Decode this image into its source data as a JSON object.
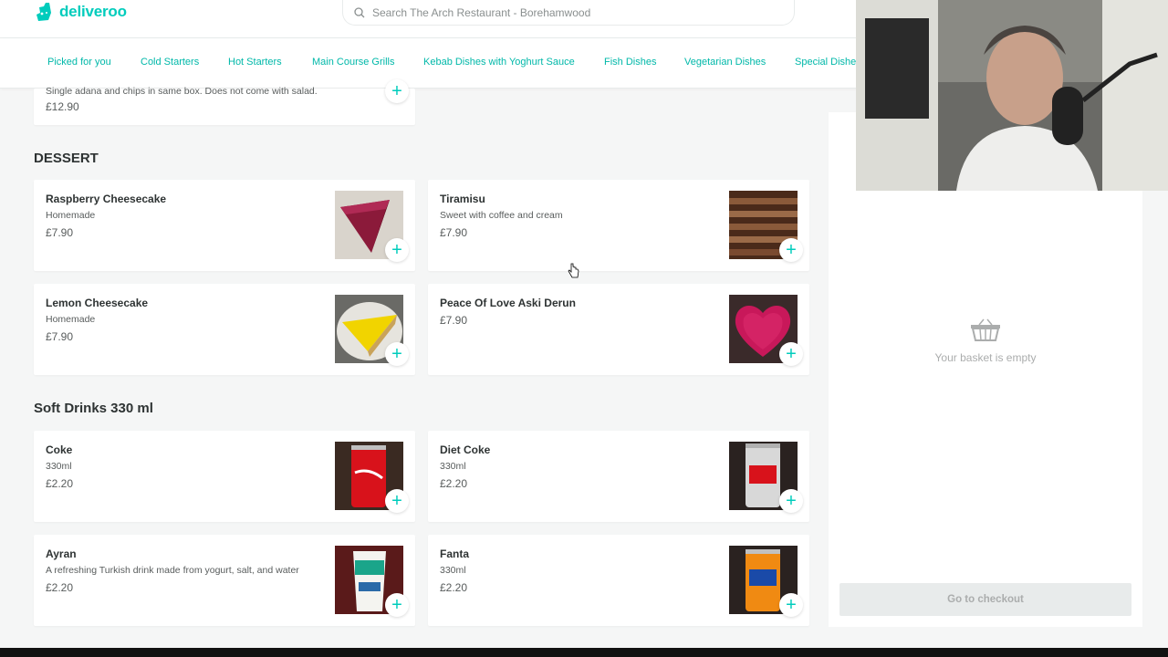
{
  "brand": {
    "name": "deliveroo",
    "color": "#00ccbc"
  },
  "search": {
    "placeholder": "Search The Arch Restaurant - Borehamwood"
  },
  "categories": [
    "Picked for you",
    "Cold Starters",
    "Hot Starters",
    "Main Course Grills",
    "Kebab Dishes with Yoghurt Sauce",
    "Fish Dishes",
    "Vegetarian Dishes",
    "Special Dishes"
  ],
  "previous_item": {
    "desc": "Single adana and chips in same box. Does not come with salad.",
    "price": "£12.90"
  },
  "sections": [
    {
      "title": "DESSERT",
      "items": [
        {
          "name": "Raspberry Cheesecake",
          "desc": "Homemade",
          "price": "£7.90",
          "image": "raspberry-cheesecake"
        },
        {
          "name": "Tiramisu",
          "desc": "Sweet with coffee and cream",
          "price": "£7.90",
          "image": "tiramisu"
        },
        {
          "name": "Lemon Cheesecake",
          "desc": "Homemade",
          "price": "£7.90",
          "image": "lemon-cheesecake"
        },
        {
          "name": "Peace Of Love Aski Derun",
          "desc": "",
          "price": "£7.90",
          "image": "heart-cake"
        }
      ]
    },
    {
      "title": "Soft Drinks 330 ml",
      "items": [
        {
          "name": "Coke",
          "desc": "330ml",
          "price": "£2.20",
          "image": "coke-can"
        },
        {
          "name": "Diet Coke",
          "desc": "330ml",
          "price": "£2.20",
          "image": "diet-coke-can"
        },
        {
          "name": "Ayran",
          "desc": "A refreshing Turkish drink made from yogurt, salt, and water",
          "price": "£2.20",
          "image": "ayran-cup"
        },
        {
          "name": "Fanta",
          "desc": "330ml",
          "price": "£2.20",
          "image": "fanta-can"
        }
      ]
    }
  ],
  "basket": {
    "empty_text": "Your basket is empty",
    "checkout_label": "Go to checkout",
    "icon": "basket-icon"
  },
  "add_icon": "plus-icon"
}
